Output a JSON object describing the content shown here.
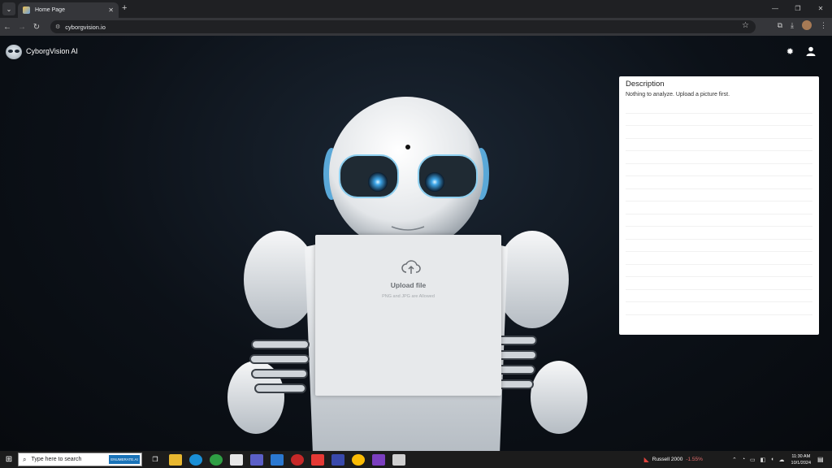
{
  "browser": {
    "tab_title": "Home Page",
    "url": "cyborgvision.io",
    "new_tab": "+",
    "tab_close": "✕",
    "win_min": "—",
    "win_max": "❐",
    "win_close": "✕"
  },
  "app": {
    "brand": "CyborgVision AI",
    "settings_icon": "gear-icon",
    "user_icon": "user-icon"
  },
  "upload": {
    "title": "Upload file",
    "subtitle": "PNG and JPG are Allowed"
  },
  "description": {
    "title": "Description",
    "text": "Nothing to analyze. Upload a picture first."
  },
  "taskbar": {
    "search_placeholder": "Type here to search",
    "search_badge": "ENUMERATE.AI",
    "ticker_name": "Russell 2000",
    "ticker_change": "-1.55%",
    "time": "11:30 AM",
    "date": "10/1/2024"
  },
  "colors": {
    "page_bg": "#0d1117",
    "card_bg": "#e7e9eb",
    "panel_bg": "#ffffff",
    "ticker_down": "#e06c6c"
  }
}
